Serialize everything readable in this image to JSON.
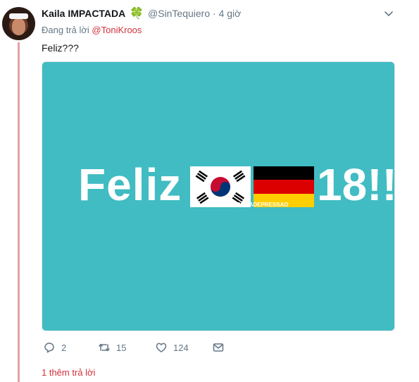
{
  "tweet": {
    "display_name": "Kaila IMPACTADA",
    "name_emoji": "🍀",
    "handle": "@SinTequiero",
    "separator": "·",
    "time": "4 giờ",
    "reply_prefix": "Đang trả lời",
    "reply_mention": "@ToniKroos",
    "text": "Feliz???"
  },
  "media": {
    "text_left": "Feliz",
    "text_right": "18!!",
    "watermark": "@RGDADEPRESSAO",
    "background_color": "#40bcc2"
  },
  "actions": {
    "reply_count": "2",
    "retweet_count": "15",
    "like_count": "124"
  },
  "thread": {
    "more_replies": "1 thêm trả lời"
  },
  "colors": {
    "accent": "#d0313b",
    "muted": "#657786",
    "thread_line": "#e0a3a6"
  }
}
